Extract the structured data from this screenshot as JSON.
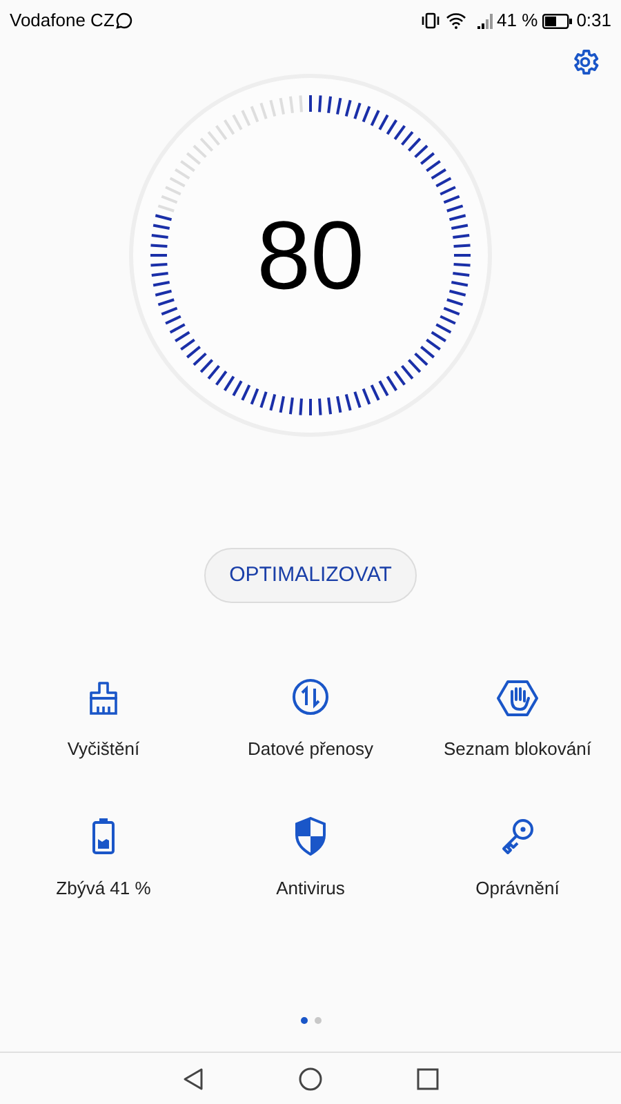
{
  "status_bar": {
    "carrier": "Vodafone CZ",
    "battery_text": "41 %",
    "time": "0:31"
  },
  "gauge": {
    "score": "80"
  },
  "optimize_button": "OPTIMALIZOVAT",
  "tiles": [
    {
      "label": "Vyčištění"
    },
    {
      "label": "Datové přenosy"
    },
    {
      "label": "Seznam blokování"
    },
    {
      "label": "Zbývá 41 %"
    },
    {
      "label": "Antivirus"
    },
    {
      "label": "Oprávnění"
    }
  ],
  "pages": [
    {
      "selected": true
    },
    {
      "selected": false
    }
  ]
}
